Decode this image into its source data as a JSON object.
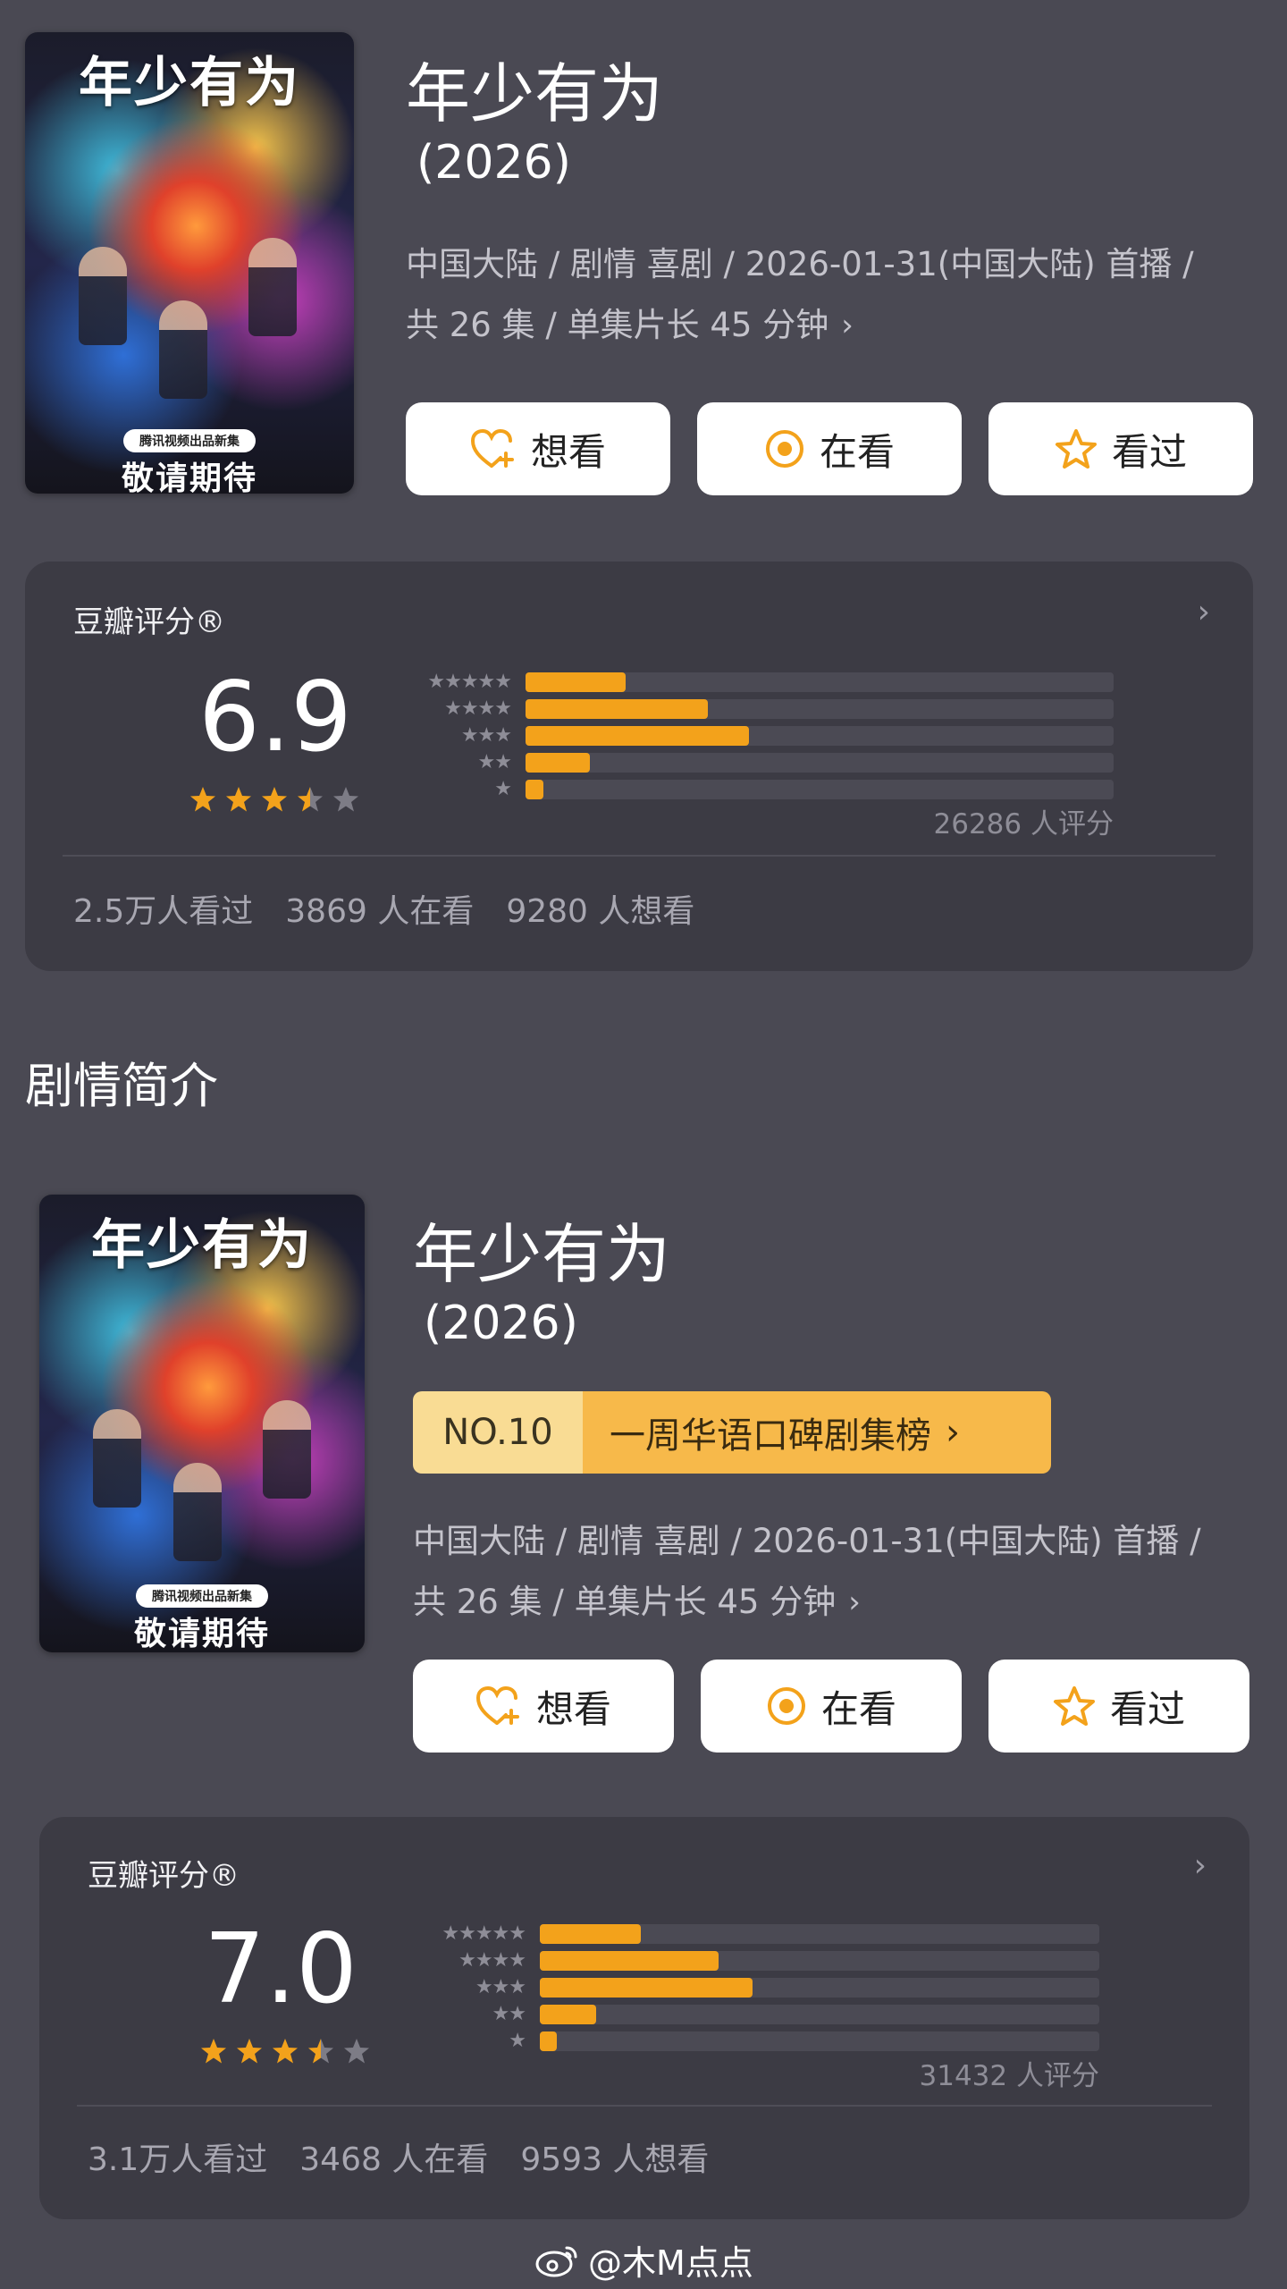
{
  "colors": {
    "background": "#4a4953",
    "card": "#3c3b44",
    "accent": "#f3a21b",
    "button": "#ffffff",
    "rank_left": "#f9dc94",
    "rank_right": "#f7b94a"
  },
  "entry1": {
    "poster": {
      "title": "年少有为",
      "pill": "腾讯视频出品新集",
      "tag": "敬请期待"
    },
    "title": "年少有为",
    "year": "(2026)",
    "meta_line1": "中国大陆 / 剧情 喜剧 / 2026-01-31(中国大陆) 首播 /",
    "meta_line2": "共 26 集 / 单集片长 45 分钟",
    "buttons": [
      {
        "label": "想看",
        "icon": "heart-plus-icon"
      },
      {
        "label": "在看",
        "icon": "target-icon"
      },
      {
        "label": "看过",
        "icon": "star-outline-icon"
      }
    ],
    "rating": {
      "label": "豆瓣评分®",
      "score": "6.9",
      "stars": 3.5,
      "distribution": [
        0.17,
        0.31,
        0.38,
        0.11,
        0.03
      ],
      "count": "26286 人评分",
      "stats": [
        "2.5万人看过",
        "3869 人在看",
        "9280 人想看"
      ]
    }
  },
  "section_title": "剧情简介",
  "entry2": {
    "poster": {
      "title": "年少有为",
      "pill": "腾讯视频出品新集",
      "tag": "敬请期待"
    },
    "title": "年少有为",
    "year": "(2026)",
    "rank": {
      "no": "NO.10",
      "name": "一周华语口碑剧集榜"
    },
    "meta_line1": "中国大陆 / 剧情 喜剧 / 2026-01-31(中国大陆) 首播 /",
    "meta_line2": "共 26 集 / 单集片长 45 分钟",
    "buttons": [
      {
        "label": "想看",
        "icon": "heart-plus-icon"
      },
      {
        "label": "在看",
        "icon": "target-icon"
      },
      {
        "label": "看过",
        "icon": "star-outline-icon"
      }
    ],
    "rating": {
      "label": "豆瓣评分®",
      "score": "7.0",
      "stars": 3.5,
      "distribution": [
        0.18,
        0.32,
        0.38,
        0.1,
        0.03
      ],
      "count": "31432 人评分",
      "stats": [
        "3.1万人看过",
        "3468 人在看",
        "9593 人想看"
      ]
    }
  },
  "watermark": "@木M点点"
}
